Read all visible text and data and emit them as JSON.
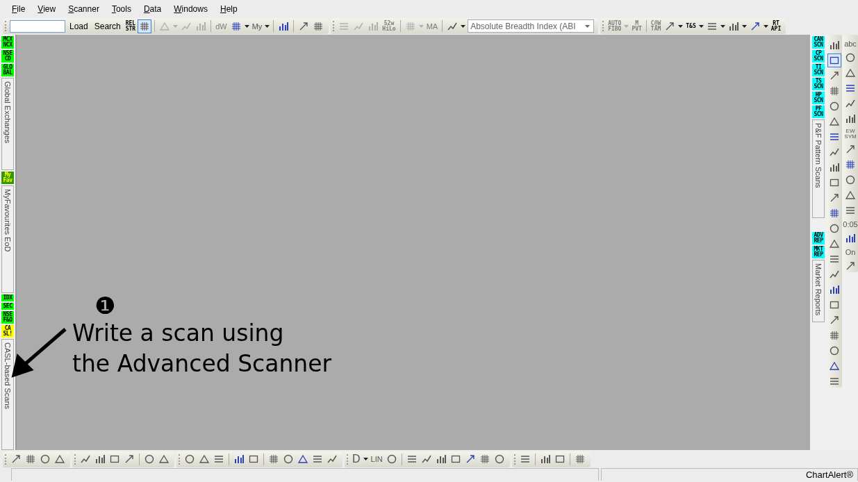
{
  "menu": [
    {
      "label": "File"
    },
    {
      "label": "View"
    },
    {
      "label": "Scanner"
    },
    {
      "label": "Tools"
    },
    {
      "label": "Data"
    },
    {
      "label": "Windows"
    },
    {
      "label": "Help"
    }
  ],
  "toolbar": [
    [
      {
        "kind": "field"
      },
      {
        "kind": "button",
        "text": "Load"
      },
      {
        "kind": "button",
        "text": "Search"
      },
      {
        "kind": "label",
        "text": "REL\nSTR",
        "disabled": false
      },
      {
        "kind": "icon",
        "disabled": false,
        "pressed": true
      },
      {
        "kind": "sep"
      },
      {
        "kind": "icon",
        "disabled": true,
        "pressed": false
      },
      {
        "kind": "caret",
        "disabled": true
      },
      {
        "kind": "icon",
        "disabled": true,
        "pressed": false
      },
      {
        "kind": "icon",
        "disabled": true,
        "pressed": false
      },
      {
        "kind": "sep"
      },
      {
        "kind": "label",
        "text": "dW",
        "disabled": true
      },
      {
        "kind": "icon",
        "disabled": false,
        "pressed": false
      },
      {
        "kind": "caret",
        "disabled": false
      },
      {
        "kind": "label",
        "text": "My",
        "disabled": false
      },
      {
        "kind": "caret",
        "disabled": false
      },
      {
        "kind": "sep"
      },
      {
        "kind": "icon",
        "disabled": false,
        "pressed": false
      },
      {
        "kind": "sep"
      },
      {
        "kind": "icon",
        "disabled": false,
        "pressed": false
      },
      {
        "kind": "icon",
        "disabled": false,
        "pressed": false
      }
    ],
    [
      {
        "kind": "icon",
        "disabled": true,
        "pressed": false
      },
      {
        "kind": "icon",
        "disabled": true,
        "pressed": false
      },
      {
        "kind": "icon",
        "disabled": true,
        "pressed": false
      },
      {
        "kind": "label",
        "text": "52w\nHiLo",
        "disabled": true
      },
      {
        "kind": "sep"
      },
      {
        "kind": "icon",
        "disabled": true,
        "pressed": false
      },
      {
        "kind": "caret",
        "disabled": true
      },
      {
        "kind": "label",
        "text": "MA",
        "disabled": true
      },
      {
        "kind": "sep"
      },
      {
        "kind": "icon",
        "disabled": false,
        "pressed": false
      },
      {
        "kind": "caret",
        "disabled": false
      },
      {
        "kind": "combo",
        "value": "Absolute Breadth Index (ABI"
      }
    ],
    [
      {
        "kind": "label",
        "text": "AUTO\nFIBO",
        "disabled": true
      },
      {
        "kind": "caret",
        "disabled": true
      },
      {
        "kind": "label",
        "text": "M\nPVT",
        "disabled": true
      },
      {
        "kind": "sep"
      },
      {
        "kind": "label",
        "text": "C@W\nTAM",
        "disabled": true
      },
      {
        "kind": "icon",
        "disabled": false,
        "pressed": false
      },
      {
        "kind": "caret",
        "disabled": false
      },
      {
        "kind": "label",
        "text": "T&S",
        "disabled": false
      },
      {
        "kind": "caret",
        "disabled": false
      },
      {
        "kind": "icon",
        "disabled": false,
        "pressed": false
      },
      {
        "kind": "caret",
        "disabled": false
      },
      {
        "kind": "icon",
        "disabled": false,
        "pressed": false
      },
      {
        "kind": "caret",
        "disabled": false
      },
      {
        "kind": "icon",
        "disabled": false,
        "pressed": false
      },
      {
        "kind": "caret",
        "disabled": false
      },
      {
        "kind": "label",
        "text": "RT\nAPI",
        "disabled": false
      }
    ]
  ],
  "left_sidebar": [
    {
      "badges": [
        {
          "text": "MCX\nNCX",
          "color": "#00ff00"
        },
        {
          "text": "NSE\nCD",
          "color": "#00ff00"
        },
        {
          "text": "GLO\nBAL",
          "color": "#00ff00"
        }
      ],
      "label": "Global Exchanges"
    },
    {
      "badges": [
        {
          "text": "My\nFav",
          "color": "#339900"
        }
      ],
      "label": "MyFavourites EoD"
    },
    {
      "badges": [
        {
          "text": "IDX",
          "color": "#00ff00"
        },
        {
          "text": "SEC",
          "color": "#00ff00"
        },
        {
          "text": "NSE\nF&O",
          "color": "#00ff00"
        },
        {
          "text": "CA\nSL!",
          "color": "#ffff00"
        }
      ],
      "label": "CASL-based Scans"
    }
  ],
  "right_sidebar": [
    {
      "badges": [
        {
          "text": "CAN\nSCN",
          "color": "#00ffff"
        },
        {
          "text": "CP\nSCN",
          "color": "#00ffff"
        },
        {
          "text": "TI\nSCN",
          "color": "#00ffff"
        },
        {
          "text": "TS\nSCN",
          "color": "#00ffff"
        },
        {
          "text": "HP\nSCN",
          "color": "#00ffff"
        },
        {
          "text": "PF\nSCN",
          "color": "#00ffff"
        }
      ],
      "label": "P&F Pattern Scans"
    },
    {
      "badges": [
        {
          "text": "ADV\nREP",
          "color": "#00ffff"
        },
        {
          "text": "MKT\nREP",
          "color": "#00ffff"
        }
      ],
      "label": "Market Reports"
    }
  ],
  "drawing_tools": [
    [
      {
        "kind": "icon",
        "pressed": false
      },
      {
        "kind": "icon",
        "pressed": true
      },
      {
        "kind": "icon",
        "pressed": false
      },
      {
        "kind": "icon",
        "pressed": false
      },
      {
        "kind": "icon",
        "pressed": false
      },
      {
        "kind": "icon",
        "pressed": false
      },
      {
        "kind": "icon",
        "pressed": false
      },
      {
        "kind": "icon",
        "pressed": false
      },
      {
        "kind": "icon",
        "pressed": false
      },
      {
        "kind": "icon",
        "pressed": false
      },
      {
        "kind": "icon",
        "pressed": false
      },
      {
        "kind": "icon",
        "pressed": false
      },
      {
        "kind": "icon",
        "pressed": false
      },
      {
        "kind": "icon",
        "pressed": false
      },
      {
        "kind": "icon",
        "pressed": false
      },
      {
        "kind": "icon",
        "pressed": false
      },
      {
        "kind": "icon",
        "pressed": false
      },
      {
        "kind": "icon",
        "pressed": false
      },
      {
        "kind": "icon",
        "pressed": false
      },
      {
        "kind": "icon",
        "pressed": false
      },
      {
        "kind": "icon",
        "pressed": false
      },
      {
        "kind": "icon",
        "pressed": false
      },
      {
        "kind": "icon",
        "pressed": false
      }
    ],
    [
      {
        "kind": "label",
        "text": "abc"
      },
      {
        "kind": "icon",
        "pressed": false
      },
      {
        "kind": "icon",
        "pressed": false
      },
      {
        "kind": "icon",
        "pressed": false
      },
      {
        "kind": "icon",
        "pressed": false
      },
      {
        "kind": "icon",
        "pressed": false
      },
      {
        "kind": "label",
        "text": "EW\nSYM"
      },
      {
        "kind": "icon",
        "pressed": false
      },
      {
        "kind": "icon",
        "pressed": false
      },
      {
        "kind": "icon",
        "pressed": false
      },
      {
        "kind": "icon",
        "pressed": false
      },
      {
        "kind": "icon",
        "pressed": false
      },
      {
        "kind": "label",
        "text": "0:05"
      },
      {
        "kind": "icon",
        "pressed": false
      },
      {
        "kind": "label",
        "text": "On"
      },
      {
        "kind": "icon",
        "pressed": false
      }
    ]
  ],
  "annotation": {
    "number": "❶",
    "text": "Write a scan using\nthe Advanced Scanner"
  },
  "bottom_toolbar": [
    [
      {
        "kind": "icon"
      },
      {
        "kind": "icon"
      },
      {
        "kind": "icon"
      },
      {
        "kind": "icon"
      }
    ],
    [
      {
        "kind": "icon"
      },
      {
        "kind": "icon"
      },
      {
        "kind": "icon"
      },
      {
        "kind": "icon"
      },
      {
        "kind": "sep"
      },
      {
        "kind": "icon"
      },
      {
        "kind": "icon"
      }
    ],
    [
      {
        "kind": "icon"
      },
      {
        "kind": "icon"
      },
      {
        "kind": "icon"
      },
      {
        "kind": "sep"
      },
      {
        "kind": "icon"
      },
      {
        "kind": "icon"
      },
      {
        "kind": "sep"
      },
      {
        "kind": "icon"
      },
      {
        "kind": "icon"
      },
      {
        "kind": "icon"
      },
      {
        "kind": "icon"
      },
      {
        "kind": "icon"
      }
    ],
    [
      {
        "kind": "label",
        "text": "D"
      },
      {
        "kind": "caret"
      },
      {
        "kind": "label",
        "text": "LIN"
      },
      {
        "kind": "icon"
      },
      {
        "kind": "sep"
      },
      {
        "kind": "icon"
      },
      {
        "kind": "icon"
      },
      {
        "kind": "icon"
      },
      {
        "kind": "icon"
      },
      {
        "kind": "icon"
      },
      {
        "kind": "icon"
      },
      {
        "kind": "icon"
      }
    ],
    [
      {
        "kind": "icon"
      },
      {
        "kind": "sep"
      },
      {
        "kind": "icon"
      },
      {
        "kind": "icon"
      },
      {
        "kind": "sep"
      },
      {
        "kind": "icon"
      }
    ]
  ],
  "status_bar": {
    "app_name": "ChartAlert®"
  }
}
